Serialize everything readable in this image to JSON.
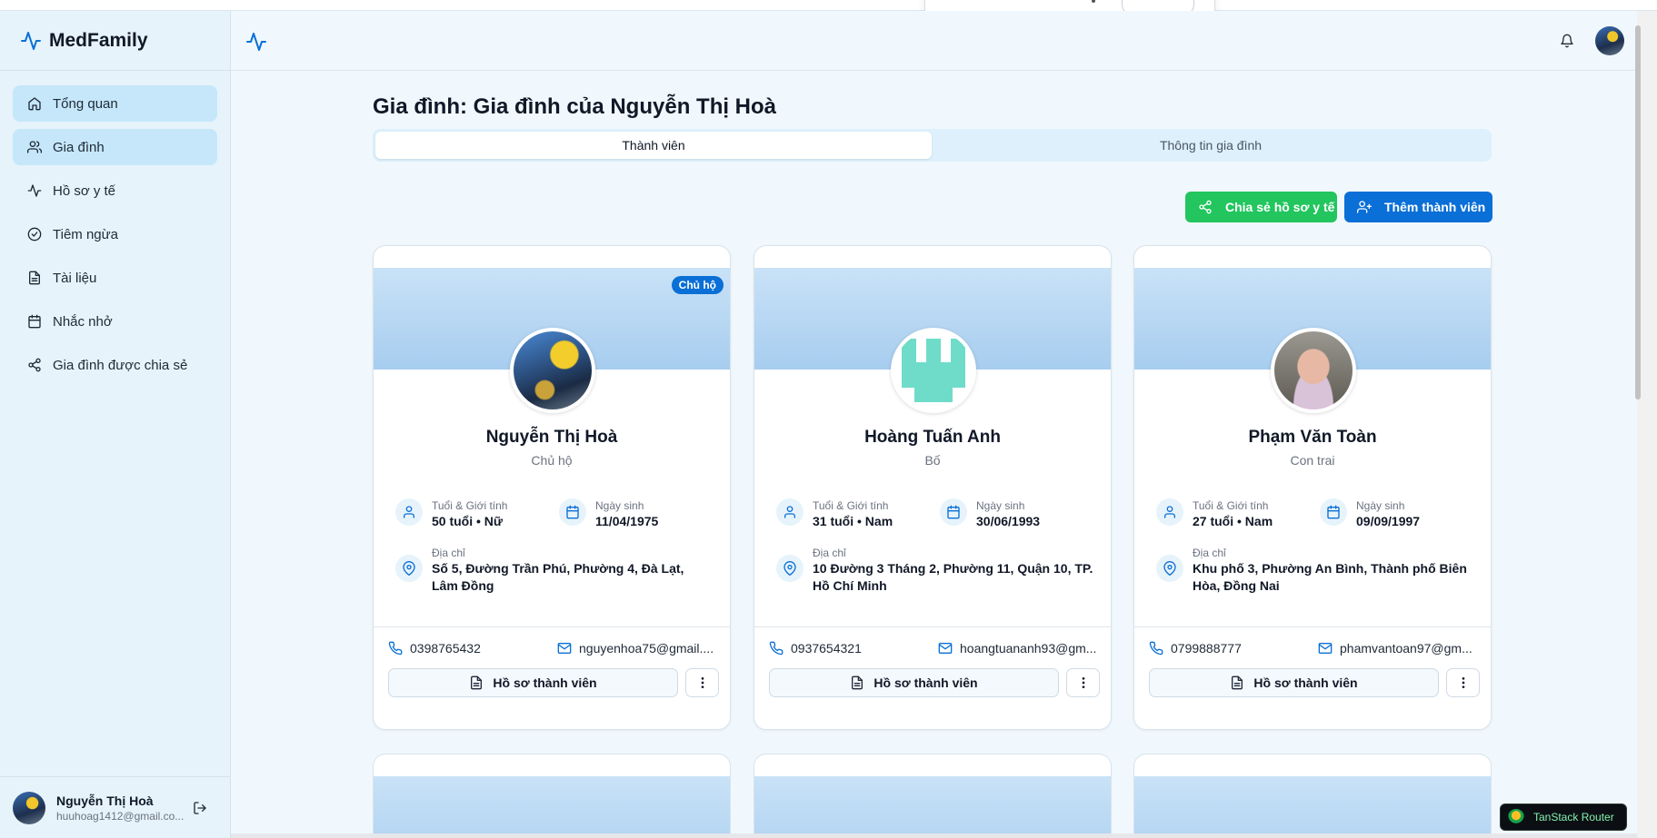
{
  "app": {
    "name": "MedFamily"
  },
  "sidebar": {
    "items": [
      {
        "label": "Tổng quan",
        "icon": "home-icon",
        "active": true
      },
      {
        "label": "Gia đình",
        "icon": "users-icon",
        "active": true
      },
      {
        "label": "Hồ sơ y tế",
        "icon": "activity-icon",
        "active": false
      },
      {
        "label": "Tiêm ngừa",
        "icon": "check-circle-icon",
        "active": false
      },
      {
        "label": "Tài liệu",
        "icon": "file-icon",
        "active": false
      },
      {
        "label": "Nhắc nhở",
        "icon": "calendar-icon",
        "active": false
      },
      {
        "label": "Gia đình được chia sẻ",
        "icon": "share-icon",
        "active": false
      }
    ],
    "user": {
      "name": "Nguyễn Thị Hoà",
      "email": "huuhoag1412@gmail.co..."
    }
  },
  "page": {
    "title": "Gia đình: Gia đình của Nguyễn Thị Hoà",
    "tabs": [
      {
        "label": "Thành viên",
        "active": true
      },
      {
        "label": "Thông tin gia đình",
        "active": false
      }
    ],
    "actions": {
      "share_label": "Chia sẻ hồ sơ y tế",
      "add_label": "Thêm thành viên"
    }
  },
  "labels": {
    "age_gender": "Tuổi & Giới tính",
    "birthday": "Ngày sinh",
    "address": "Địa chỉ",
    "profile_button": "Hồ sơ thành viên",
    "head_badge": "Chủ hộ"
  },
  "members": [
    {
      "name": "Nguyễn Thị Hoà",
      "role": "Chủ hộ",
      "age_gender": "50 tuổi • Nữ",
      "birthday": "11/04/1975",
      "address": "Số 5, Đường Trần Phú, Phường 4, Đà Lạt, Lâm Đồng",
      "phone": "0398765432",
      "email": "nguyenhoa75@gmail....",
      "is_head": true
    },
    {
      "name": "Hoàng Tuấn Anh",
      "role": "Bố",
      "age_gender": "31 tuổi • Nam",
      "birthday": "30/06/1993",
      "address": "10 Đường 3 Tháng 2, Phường 11, Quận 10, TP. Hồ Chí Minh",
      "phone": "0937654321",
      "email": "hoangtuananh93@gm...",
      "is_head": false
    },
    {
      "name": "Phạm Văn Toàn",
      "role": "Con trai",
      "age_gender": "27 tuổi • Nam",
      "birthday": "09/09/1997",
      "address": "Khu phố 3, Phường An Bình, Thành phố Biên Hòa, Đồng Nai",
      "phone": "0799888777",
      "email": "phamvantoan97@gm...",
      "is_head": false
    }
  ],
  "devtools": {
    "label": "TanStack Router"
  },
  "colors": {
    "primary": "#0a6fd6",
    "success": "#22c55e",
    "sidebar_bg": "#e6f3fb",
    "active_nav": "#c5e7f9"
  }
}
